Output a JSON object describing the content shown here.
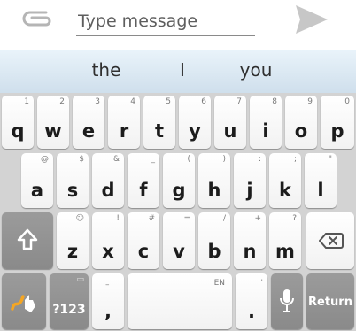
{
  "compose": {
    "placeholder": "Type message",
    "attach_icon": "paperclip-icon",
    "send_icon": "send-arrow-icon"
  },
  "suggestions": [
    "the",
    "I",
    "you"
  ],
  "keyboard": {
    "row1": [
      {
        "label": "q",
        "hint": "1"
      },
      {
        "label": "w",
        "hint": "2"
      },
      {
        "label": "e",
        "hint": "3"
      },
      {
        "label": "r",
        "hint": "4"
      },
      {
        "label": "t",
        "hint": "5"
      },
      {
        "label": "y",
        "hint": "6"
      },
      {
        "label": "u",
        "hint": "7"
      },
      {
        "label": "i",
        "hint": "8"
      },
      {
        "label": "o",
        "hint": "9"
      },
      {
        "label": "p",
        "hint": "0"
      }
    ],
    "row2": [
      {
        "label": "a",
        "hint": "@"
      },
      {
        "label": "s",
        "hint": "$"
      },
      {
        "label": "d",
        "hint": "&"
      },
      {
        "label": "f",
        "hint": "_"
      },
      {
        "label": "g",
        "hint": "("
      },
      {
        "label": "h",
        "hint": ")"
      },
      {
        "label": "j",
        "hint": ":"
      },
      {
        "label": "k",
        "hint": ";"
      },
      {
        "label": "l",
        "hint": "\""
      }
    ],
    "row3": [
      {
        "label": "z",
        "hint": "☺"
      },
      {
        "label": "x",
        "hint": "!"
      },
      {
        "label": "c",
        "hint": "#"
      },
      {
        "label": "v",
        "hint": "="
      },
      {
        "label": "b",
        "hint": "/"
      },
      {
        "label": "n",
        "hint": "+"
      },
      {
        "label": "m",
        "hint": "?"
      }
    ],
    "shift_icon": "shift-arrow-icon",
    "backspace_icon": "backspace-icon",
    "swype_icon": "swype-logo-icon",
    "symbols_label": "?123",
    "comma_label": ",",
    "comma_hint": "–",
    "space_hint": "EN",
    "period_label": ".",
    "period_hint": "'",
    "mic_icon": "microphone-icon",
    "return_label": "Return"
  }
}
